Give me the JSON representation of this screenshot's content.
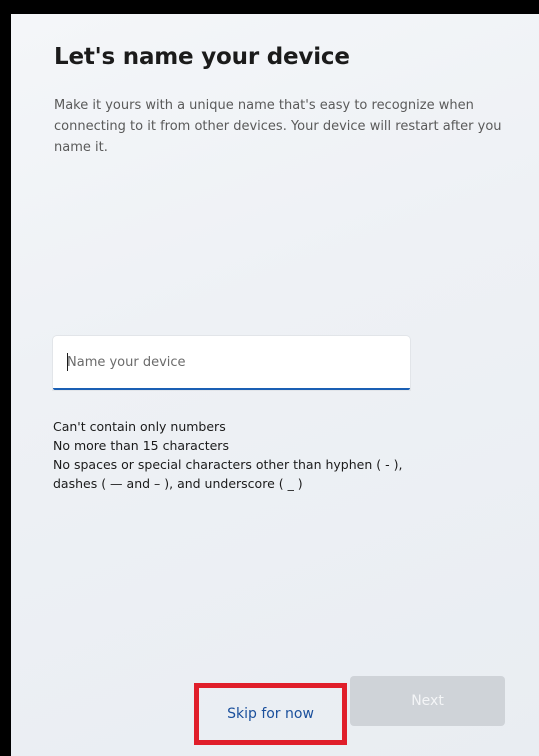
{
  "page": {
    "title": "Let's name your device",
    "description": "Make it yours with a unique name that's easy to recognize when connecting to it from other devices. Your device will restart after you name it."
  },
  "device_name": {
    "value": "",
    "placeholder": "Name your device"
  },
  "rules": [
    "Can't contain only numbers",
    "No more than 15 characters",
    "No spaces or special characters other than hyphen ( - ),",
    "dashes ( — and – ), and underscore ( _ )"
  ],
  "actions": {
    "skip_label": "Skip for now",
    "next_label": "Next"
  },
  "colors": {
    "accent": "#1a5fb4",
    "link": "#1a4f9c",
    "highlight": "#e01e2a",
    "disabled_button": "#cfd3d8"
  }
}
